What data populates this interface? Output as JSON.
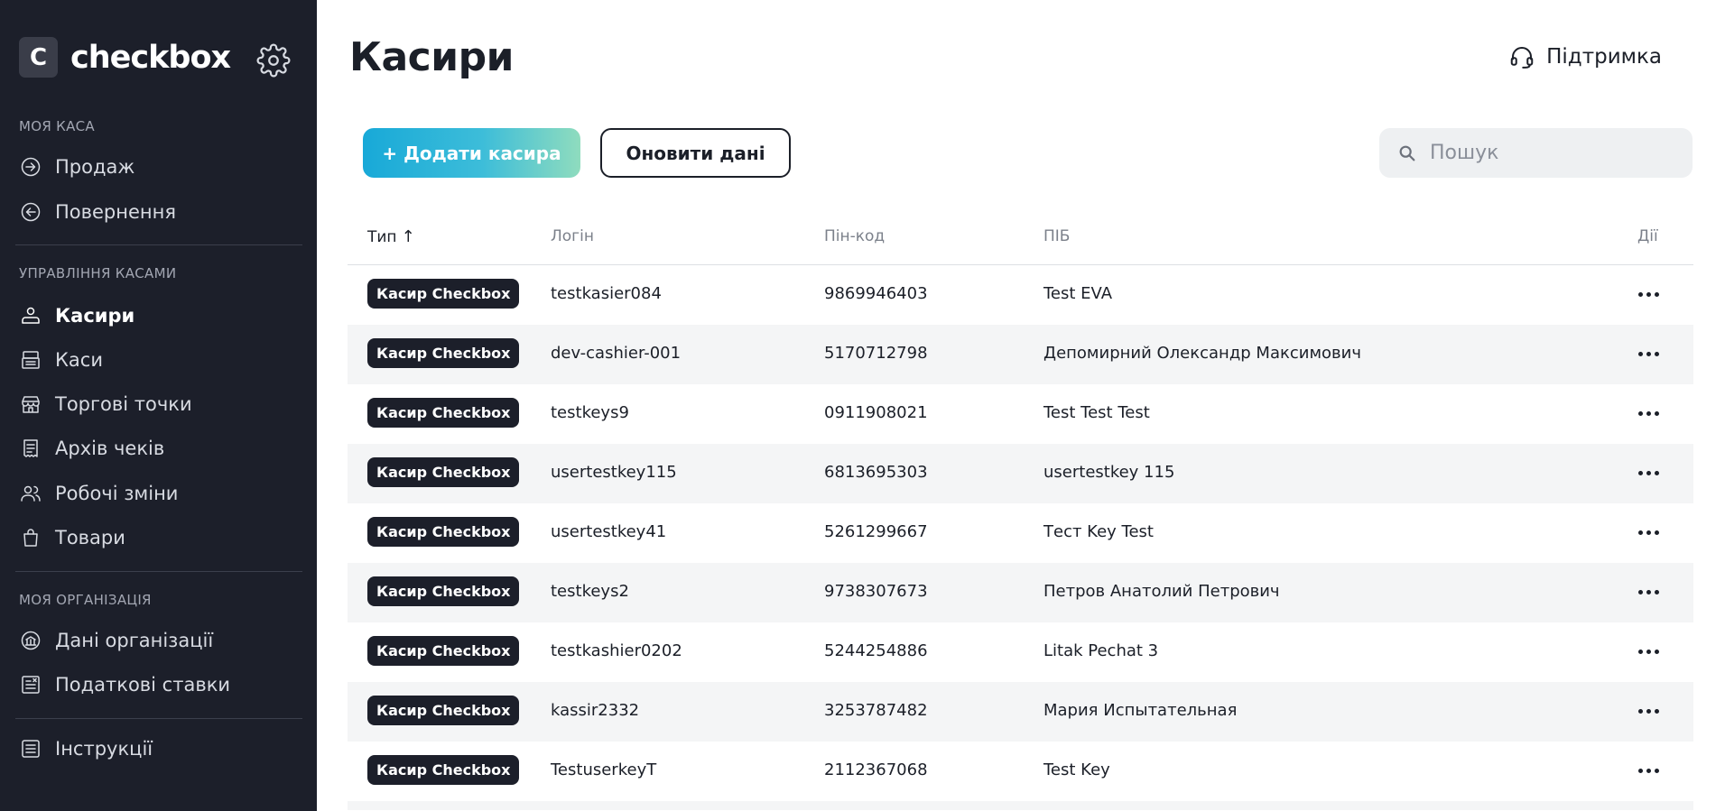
{
  "sidebar": {
    "logo_letter": "C",
    "brand": "checkbox",
    "sections": [
      {
        "title": "Моя каса",
        "items": [
          {
            "label": "Продаж",
            "icon": "sale-arrow-icon"
          },
          {
            "label": "Повернення",
            "icon": "return-arrow-icon"
          }
        ]
      },
      {
        "title": "Управління касами",
        "items": [
          {
            "label": "Касири",
            "icon": "cashiers-icon",
            "active": true
          },
          {
            "label": "Каси",
            "icon": "cash-register-icon"
          },
          {
            "label": "Торгові точки",
            "icon": "store-icon"
          },
          {
            "label": "Архів чеків",
            "icon": "receipt-archive-icon"
          },
          {
            "label": "Робочі зміни",
            "icon": "shifts-icon"
          },
          {
            "label": "Товари",
            "icon": "shopping-bag-icon"
          }
        ]
      },
      {
        "title": "Моя організація",
        "items": [
          {
            "label": "Дані організації",
            "icon": "organization-icon"
          },
          {
            "label": "Податкові ставки",
            "icon": "tax-rates-icon"
          }
        ]
      }
    ],
    "footer_item": {
      "label": "Інструкції",
      "icon": "instructions-icon"
    }
  },
  "header": {
    "title": "Касири",
    "support_label": "Підтримка"
  },
  "toolbar": {
    "add_label": "+ Додати касира",
    "refresh_label": "Оновити дані",
    "search_placeholder": "Пошук"
  },
  "table": {
    "columns": [
      "Тип",
      "Логін",
      "Пін-код",
      "ПІБ",
      "Дії"
    ],
    "sort_indicator": "↑",
    "rows": [
      {
        "type": "Касир Checkbox",
        "login": "testkasier084",
        "pin": "9869946403",
        "name": "Test EVA"
      },
      {
        "type": "Касир Checkbox",
        "login": "dev-cashier-001",
        "pin": "5170712798",
        "name": "Депомирний Олександр Максимович"
      },
      {
        "type": "Касир Checkbox",
        "login": "testkeys9",
        "pin": "0911908021",
        "name": "Test Test Test"
      },
      {
        "type": "Касир Checkbox",
        "login": "usertestkey115",
        "pin": "6813695303",
        "name": "usertestkey 115"
      },
      {
        "type": "Касир Checkbox",
        "login": "usertestkey41",
        "pin": "5261299667",
        "name": "Тест Key Test"
      },
      {
        "type": "Касир Checkbox",
        "login": "testkeys2",
        "pin": "9738307673",
        "name": "Петров Анатолий Петрович"
      },
      {
        "type": "Касир Checkbox",
        "login": "testkashier0202",
        "pin": "5244254886",
        "name": "Litak Pechat 3"
      },
      {
        "type": "Касир Checkbox",
        "login": "kassir2332",
        "pin": "3253787482",
        "name": "Мария Испытательная"
      },
      {
        "type": "Касир Checkbox",
        "login": "TestuserkeyT",
        "pin": "2112367068",
        "name": "Test Key"
      }
    ]
  },
  "colors": {
    "sidebar_bg": "#1c1f2a",
    "accent_gradient_start": "#18a9d8",
    "accent_gradient_end": "#8fdcbe",
    "badge_bg": "#1c1f2a",
    "row_alt_bg": "#f4f5f6"
  }
}
